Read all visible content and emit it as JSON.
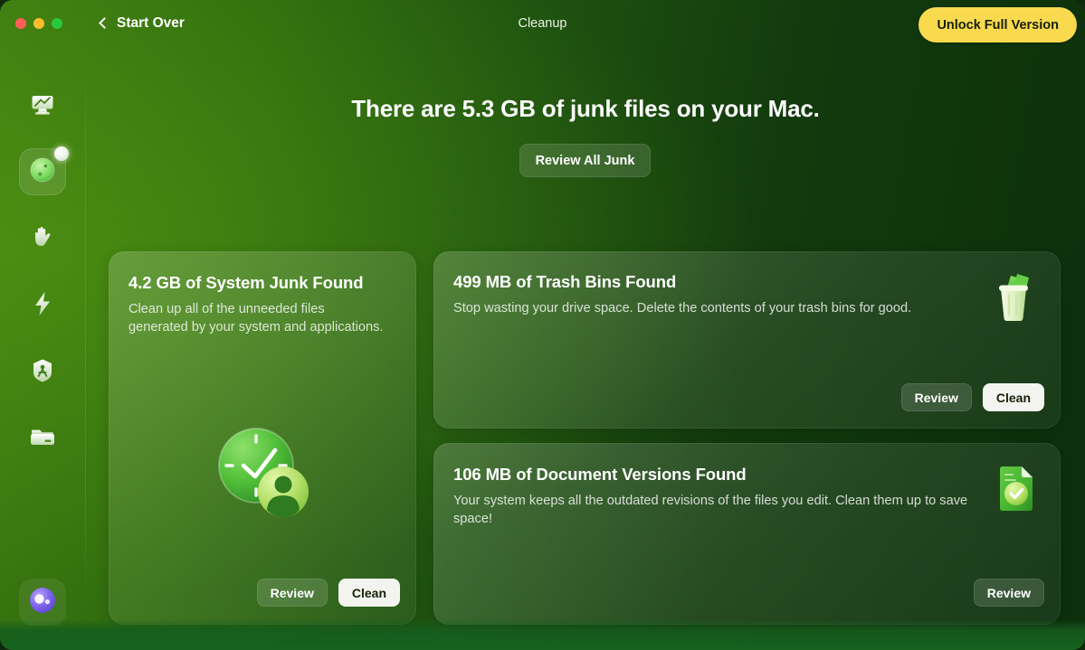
{
  "window": {
    "title": "Cleanup",
    "back_label": "Start Over",
    "unlock_label": "Unlock Full Version",
    "traffic_lights": [
      "close-button",
      "minimize-button",
      "zoom-button"
    ],
    "colors": {
      "accent_yellow": "#f9d94e",
      "bg_green_light": "#3c7a10",
      "bg_green_dark": "#0c2f0c",
      "button_solid": "#f3f4ef"
    }
  },
  "sidebar": {
    "items": [
      {
        "icon": "monitor-scan-icon",
        "name": "sidebar-item-smart-scan",
        "active": false
      },
      {
        "icon": "cleanup-icon",
        "name": "sidebar-item-cleanup",
        "active": true,
        "has_badge": true
      },
      {
        "icon": "hand-protection-icon",
        "name": "sidebar-item-protection",
        "active": false
      },
      {
        "icon": "lightning-performance-icon",
        "name": "sidebar-item-performance",
        "active": false
      },
      {
        "icon": "shield-applications-icon",
        "name": "sidebar-item-applications",
        "active": false
      },
      {
        "icon": "drawer-files-icon",
        "name": "sidebar-item-my-clutter",
        "active": false
      }
    ],
    "avatar": {
      "icon": "account-avatar-icon",
      "name": "sidebar-avatar"
    }
  },
  "main": {
    "headline": "There are 5.3 GB of junk files on your Mac.",
    "review_all_label": "Review All Junk",
    "cards": [
      {
        "id": "system-junk",
        "title": "4.2 GB of System Junk Found",
        "description": "Clean up all of the unneeded files generated by your system and applications.",
        "icon": "clock-user-icon",
        "buttons": [
          {
            "label": "Review",
            "style": "ghost"
          },
          {
            "label": "Clean",
            "style": "solid"
          }
        ]
      },
      {
        "id": "trash-bins",
        "title": "499 MB of Trash Bins Found",
        "description": "Stop wasting your drive space. Delete the contents of your trash bins for good.",
        "icon": "trash-bin-icon",
        "buttons": [
          {
            "label": "Review",
            "style": "ghost"
          },
          {
            "label": "Clean",
            "style": "solid"
          }
        ]
      },
      {
        "id": "document-versions",
        "title": "106 MB of Document Versions Found",
        "description": "Your system keeps all the outdated revisions of the files you edit. Clean them up to save space!",
        "icon": "document-check-icon",
        "buttons": [
          {
            "label": "Review",
            "style": "ghost"
          }
        ]
      }
    ]
  }
}
